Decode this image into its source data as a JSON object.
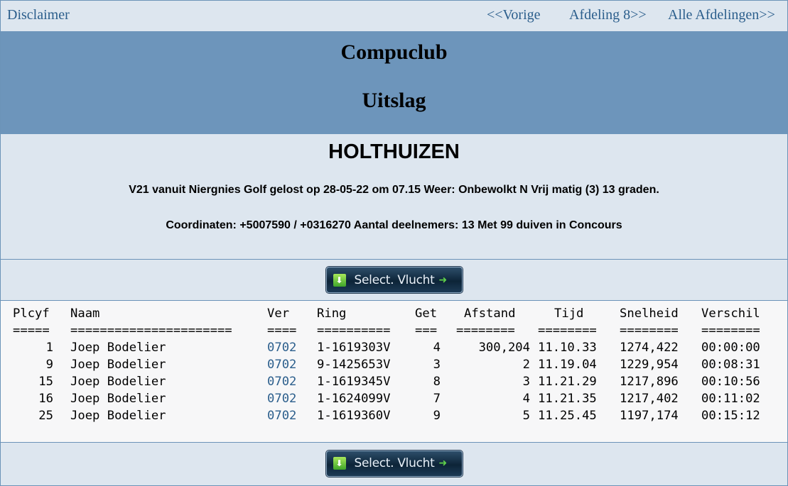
{
  "nav": {
    "disclaimer": "Disclaimer",
    "prev": "<<Vorige",
    "afdeling": "Afdeling 8>>",
    "alle": "Alle Afdelingen>>"
  },
  "banner": {
    "title1": "Compuclub",
    "title2": "Uitslag"
  },
  "info": {
    "place": "HOLTHUIZEN",
    "line1": "V21 vanuit Niergnies Golf gelost op 28-05-22 om 07.15 Weer: Onbewolkt N Vrij matig (3) 13 graden.",
    "line2": "Coordinaten: +5007590 / +0316270 Aantal deelnemers: 13 Met 99 duiven in Concours"
  },
  "button": {
    "label": "Select. Vlucht"
  },
  "table": {
    "headers": [
      "Plcyf",
      "Naam",
      "Ver",
      "Ring",
      "Get",
      "Afstand",
      "Tijd",
      "Snelheid",
      "Verschil"
    ],
    "separators": [
      "=====",
      "======================",
      "====",
      "==========",
      "===",
      "========",
      "========",
      "========",
      "========"
    ],
    "rows": [
      [
        "1",
        "Joep Bodelier",
        "0702",
        "1-1619303V",
        "4",
        "300,204",
        "11.10.33",
        "1274,422",
        "00:00:00"
      ],
      [
        "9",
        "Joep Bodelier",
        "0702",
        "9-1425653V",
        "3",
        "2",
        "11.19.04",
        "1229,954",
        "00:08:31"
      ],
      [
        "15",
        "Joep Bodelier",
        "0702",
        "1-1619345V",
        "8",
        "3",
        "11.21.29",
        "1217,896",
        "00:10:56"
      ],
      [
        "16",
        "Joep Bodelier",
        "0702",
        "1-1624099V",
        "7",
        "4",
        "11.21.35",
        "1217,402",
        "00:11:02"
      ],
      [
        "25",
        "Joep Bodelier",
        "0702",
        "1-1619360V",
        "9",
        "5",
        "11.25.45",
        "1197,174",
        "00:15:12"
      ]
    ]
  },
  "colors": {
    "banner": "#6d95bb",
    "background": "#dde6ef",
    "link": "#2b5e8c"
  }
}
